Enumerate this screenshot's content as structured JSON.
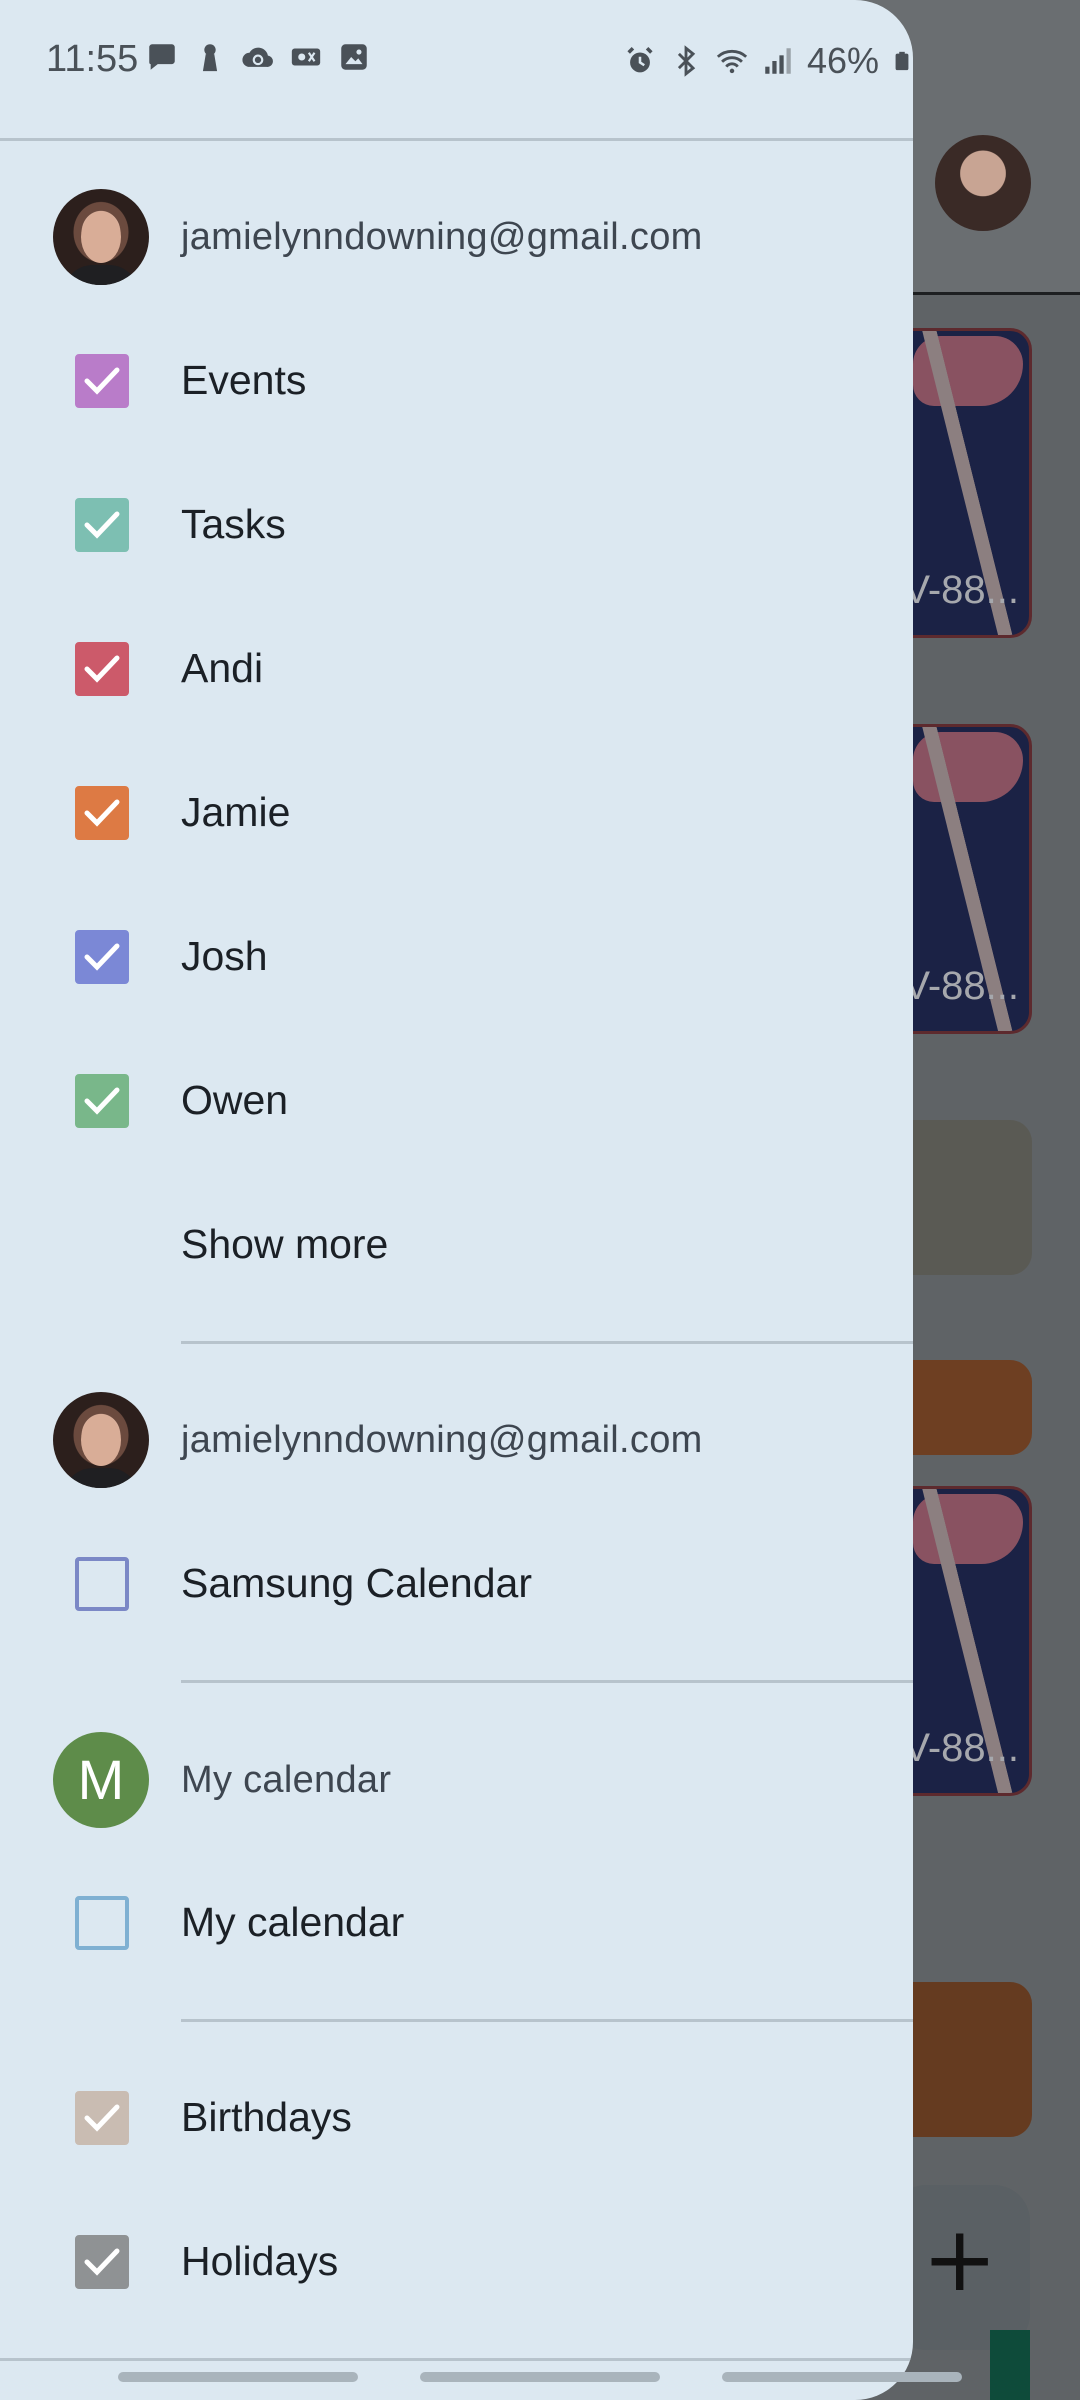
{
  "status_bar": {
    "time": "11:55",
    "battery": "46%",
    "left_icons": [
      "chat-bubble-icon",
      "keyhole-icon",
      "cloud-sync-icon",
      "ticket-icon",
      "image-icon"
    ],
    "right_icons": [
      "alarm-icon",
      "bluetooth-icon",
      "wifi-icon",
      "signal-icon",
      "battery-icon"
    ]
  },
  "drawer": {
    "accounts": [
      {
        "email": "jamielynndowning@gmail.com",
        "avatar": "photo",
        "calendars": [
          {
            "label": "Events",
            "checked": true,
            "color": "#b97cc9"
          },
          {
            "label": "Tasks",
            "checked": true,
            "color": "#7dbfb2"
          },
          {
            "label": "Andi",
            "checked": true,
            "color": "#cc5a6a"
          },
          {
            "label": "Jamie",
            "checked": true,
            "color": "#dd7a44"
          },
          {
            "label": "Josh",
            "checked": true,
            "color": "#7b88d6"
          },
          {
            "label": "Owen",
            "checked": true,
            "color": "#79b78a"
          }
        ],
        "show_more": "Show more"
      },
      {
        "email": "jamielynndowning@gmail.com",
        "avatar": "photo",
        "calendars": [
          {
            "label": "Samsung Calendar",
            "checked": false,
            "color": "#7b88c6"
          }
        ]
      },
      {
        "email": "My calendar",
        "avatar_letter": "M",
        "avatar_color": "#5e8c4a",
        "calendars": [
          {
            "label": "My calendar",
            "checked": false,
            "color": "#7fb0d2"
          }
        ]
      }
    ],
    "other_calendars": [
      {
        "label": "Birthdays",
        "checked": true,
        "color": "#c9bcb2"
      },
      {
        "label": "Holidays",
        "checked": true,
        "color": "#8f9294"
      }
    ]
  },
  "background": {
    "card_label": "V-88..."
  }
}
